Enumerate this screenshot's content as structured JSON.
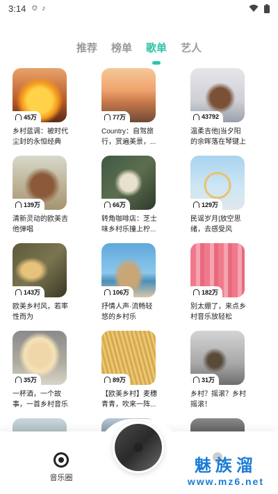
{
  "status_bar": {
    "time": "3:14",
    "icons": [
      "headset-icon",
      "music-note-icon",
      "wifi-icon",
      "battery-icon"
    ]
  },
  "tabs": [
    {
      "label": "推荐",
      "active": false
    },
    {
      "label": "榜单",
      "active": false
    },
    {
      "label": "歌单",
      "active": true
    },
    {
      "label": "艺人",
      "active": false
    }
  ],
  "playlists": [
    {
      "count": "45万",
      "title": "乡村蓝调：被时代尘封的永恒经典"
    },
    {
      "count": "77万",
      "title": "Country：自驾旅行，赏遍美景，..."
    },
    {
      "count": "43792",
      "title": "温柔吉他|当夕阳的余晖落在琴键上"
    },
    {
      "count": "139万",
      "title": "清新灵动的欧美吉他弹唱"
    },
    {
      "count": "66万",
      "title": "转角咖啡店：芝士味乡村乐撞上柠..."
    },
    {
      "count": "129万",
      "title": "民谣岁月|放空思绪，去感受风"
    },
    {
      "count": "143万",
      "title": "欧美乡村风，若率性而为"
    },
    {
      "count": "106万",
      "title": "抒情人声·流畅轻悠的乡村乐"
    },
    {
      "count": "182万",
      "title": "别太绷了，来点乡村音乐放轻松"
    },
    {
      "count": "35万",
      "title": "一杯酒，一个故事，一首乡村音乐"
    },
    {
      "count": "89万",
      "title": "【欧美乡村】麦穗青青，吹来一阵..."
    },
    {
      "count": "31万",
      "title": "乡村？摇滚？乡村摇滚！"
    }
  ],
  "bottom_nav": {
    "music_label": "音乐圈"
  },
  "watermark": {
    "top": "魅族溜",
    "bottom": "www.mz6.net"
  },
  "colors": {
    "accent": "#2ec4a6",
    "watermark": "#1a7cd6"
  }
}
